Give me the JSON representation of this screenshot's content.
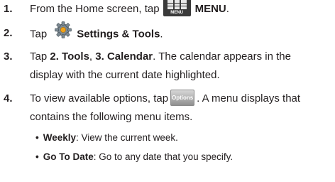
{
  "steps": [
    {
      "number": "1.",
      "prefix": "From the Home screen, tap",
      "icon": "menu-icon",
      "icon_label": "MENU",
      "bold": "MENU",
      "suffix": "."
    },
    {
      "number": "2.",
      "prefix": "Tap",
      "icon": "gear-icon",
      "bold": "Settings & Tools",
      "suffix": "."
    },
    {
      "number": "3.",
      "prefix": "Tap ",
      "bold1": "2. Tools",
      "mid": ", ",
      "bold2": "3. Calendar",
      "suffix": ". The calendar appears in the",
      "line2": "display with the current date highlighted."
    },
    {
      "number": "4.",
      "prefix": "To view available options, tap",
      "button_label": "Options",
      "suffix": ". A menu displays that",
      "line2": "contains the following menu items."
    }
  ],
  "menu_items": [
    {
      "name": "Weekly",
      "description": ": View the current week."
    },
    {
      "name": "Go To Date",
      "description": ": Go to any date that you specify."
    }
  ]
}
